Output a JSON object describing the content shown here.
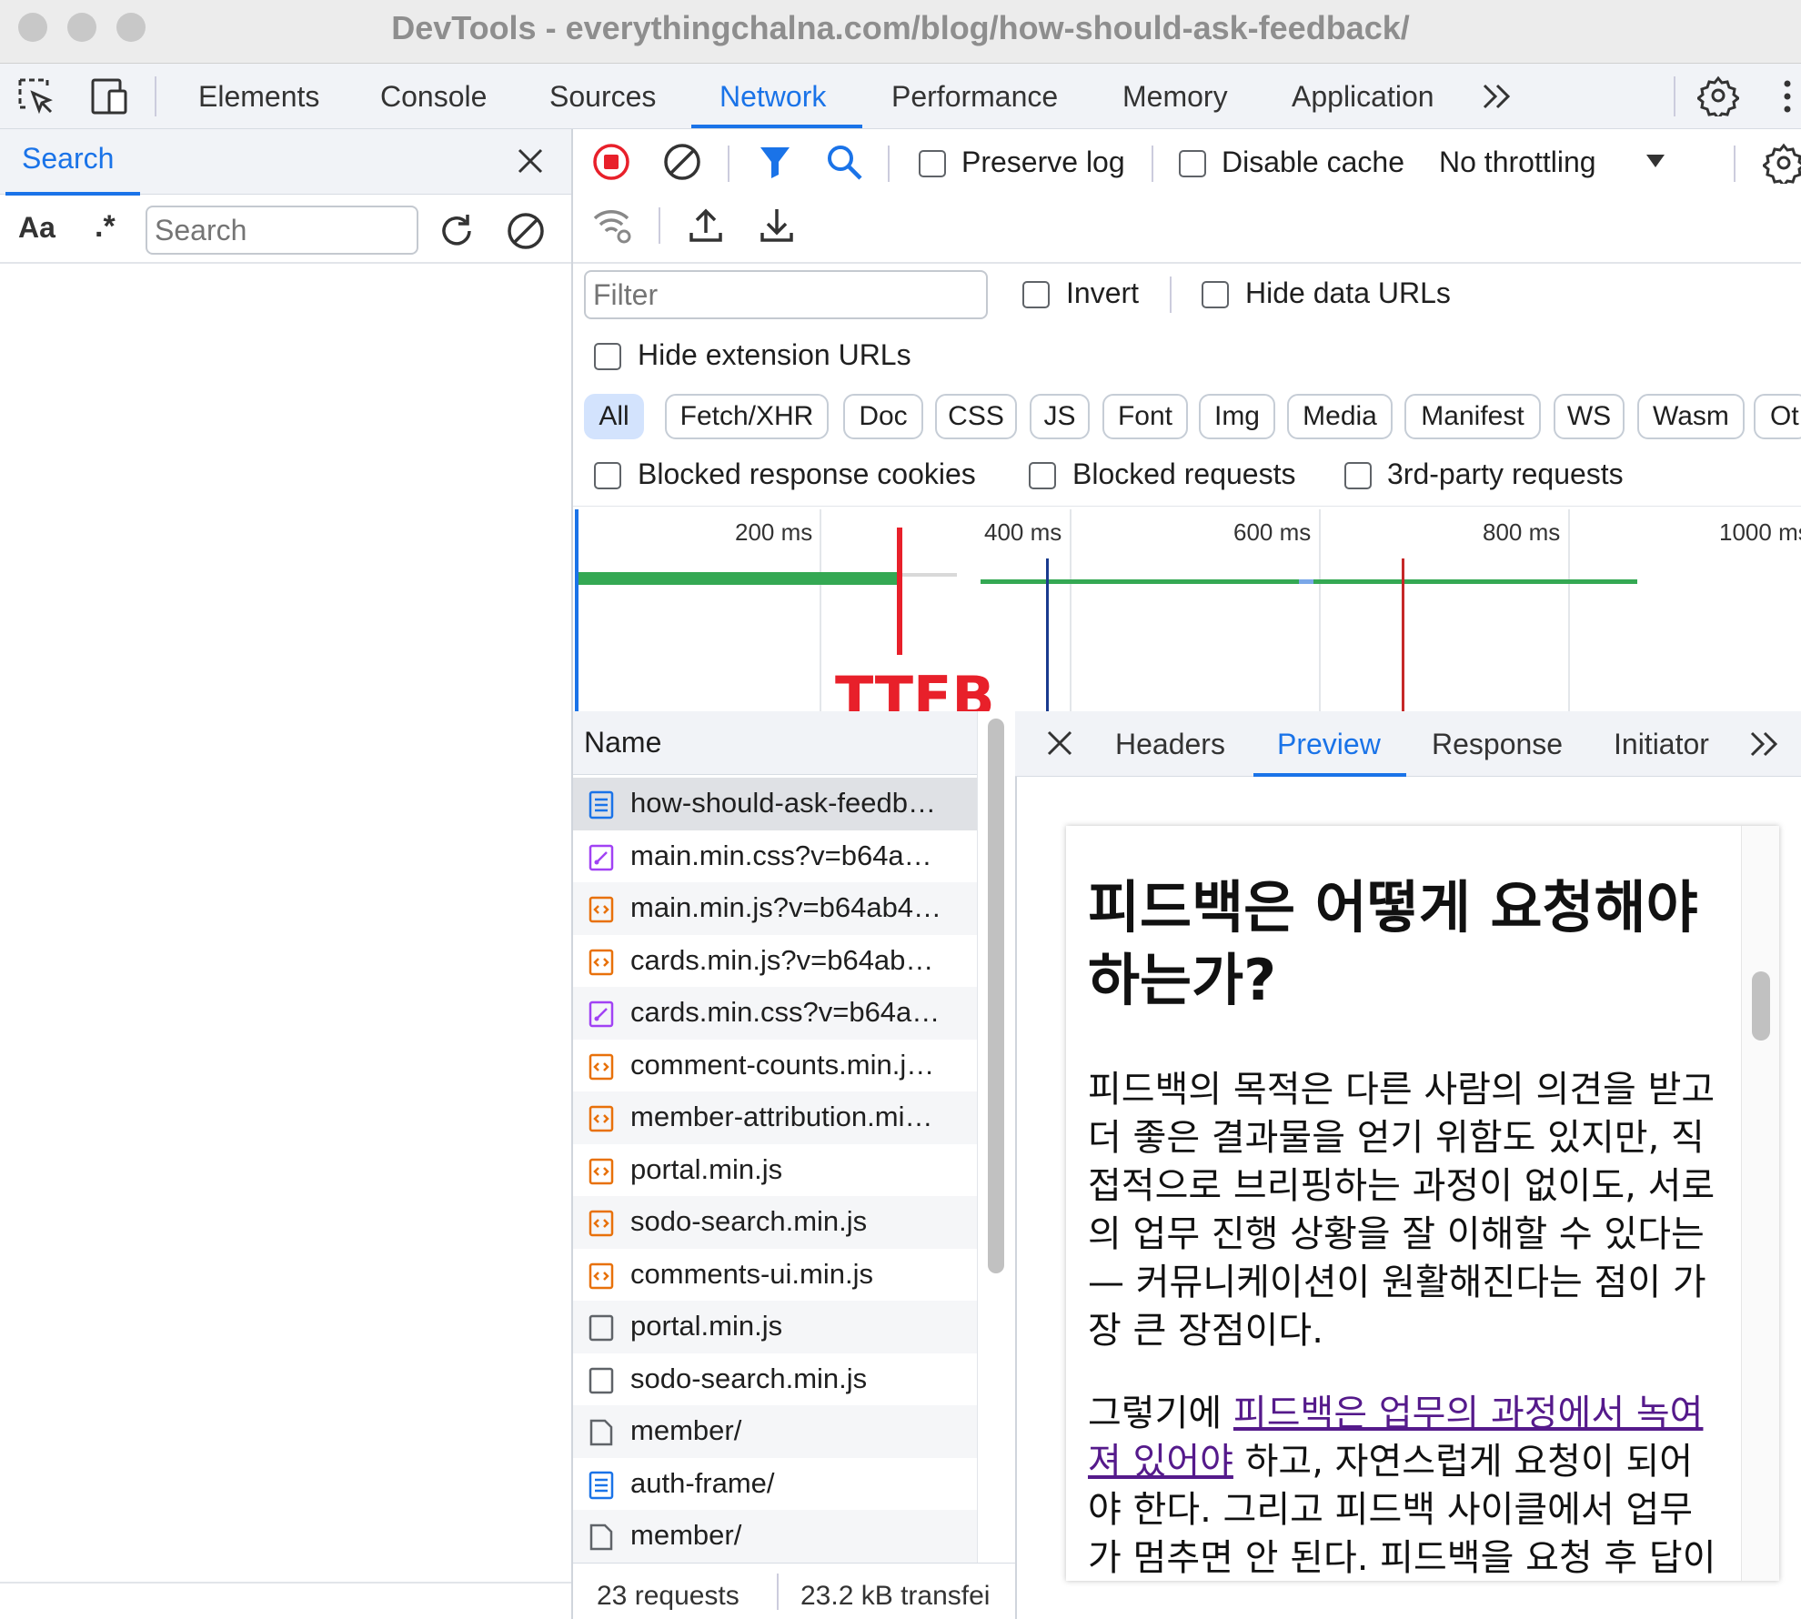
{
  "window": {
    "title": "DevTools - everythingchalna.com/blog/how-should-ask-feedback/"
  },
  "main_tabs": [
    "Elements",
    "Console",
    "Sources",
    "Network",
    "Performance",
    "Memory",
    "Application"
  ],
  "active_main_tab": "Network",
  "search_panel": {
    "title": "Search",
    "case_label": "Aa",
    "regex_label": ".*",
    "placeholder": "Search"
  },
  "network_toolbar": {
    "preserve_log": "Preserve log",
    "disable_cache": "Disable cache",
    "throttling": "No throttling"
  },
  "filter": {
    "placeholder": "Filter",
    "invert": "Invert",
    "hide_data_urls": "Hide data URLs",
    "hide_extension_urls": "Hide extension URLs"
  },
  "type_filters": [
    "All",
    "Fetch/XHR",
    "Doc",
    "CSS",
    "JS",
    "Font",
    "Img",
    "Media",
    "Manifest",
    "WS",
    "Wasm",
    "Ot"
  ],
  "active_type_filter": "All",
  "blocked": {
    "cookies": "Blocked response cookies",
    "requests": "Blocked requests",
    "third_party": "3rd-party requests"
  },
  "timeline": {
    "ticks": [
      "200 ms",
      "400 ms",
      "600 ms",
      "800 ms",
      "1000 ms"
    ],
    "annotation": "TTFB"
  },
  "requests": {
    "header": "Name",
    "rows": [
      {
        "name": "how-should-ask-feedb…",
        "icon": "document-icon"
      },
      {
        "name": "main.min.css?v=b64a…",
        "icon": "stylesheet-icon"
      },
      {
        "name": "main.min.js?v=b64ab4…",
        "icon": "script-icon"
      },
      {
        "name": "cards.min.js?v=b64ab…",
        "icon": "script-icon"
      },
      {
        "name": "cards.min.css?v=b64a…",
        "icon": "stylesheet-icon"
      },
      {
        "name": "comment-counts.min.j…",
        "icon": "script-icon"
      },
      {
        "name": "member-attribution.mi…",
        "icon": "script-icon"
      },
      {
        "name": "portal.min.js",
        "icon": "script-icon"
      },
      {
        "name": "sodo-search.min.js",
        "icon": "script-icon"
      },
      {
        "name": "comments-ui.min.js",
        "icon": "script-icon"
      },
      {
        "name": "portal.min.js",
        "icon": "blank-icon"
      },
      {
        "name": "sodo-search.min.js",
        "icon": "blank-icon"
      },
      {
        "name": "member/",
        "icon": "file-icon"
      },
      {
        "name": "auth-frame/",
        "icon": "document-icon"
      },
      {
        "name": "member/",
        "icon": "file-icon"
      }
    ]
  },
  "detail_tabs": [
    "Headers",
    "Preview",
    "Response",
    "Initiator"
  ],
  "active_detail_tab": "Preview",
  "preview": {
    "heading": "피드백은 어떻게 요청해야 하는가?",
    "paragraph1": "피드백의 목적은 다른 사람의 의견을 받고 더 좋은 결과물을 얻기 위함도 있지만, 직접적으로 브리핑하는 과정이 없이도, 서로의 업무 진행 상황을 잘 이해할 수 있다는 — 커뮤니케이션이 원활해진다는 점이 가장 큰 장점이다.",
    "paragraph2_pre": "그렇기에 ",
    "paragraph2_link": "피드백은 업무의 과정에서 녹여져 있어야",
    "paragraph2_post": " 하고, 자연스럽게 요청이 되어야 한다. 그리고 피드백 사이클에서 업무가 멈추면 안 된다. 피드백을 요청 후 답이"
  },
  "status": {
    "requests": "23 requests",
    "transferred": "23.2 kB transfei"
  },
  "colors": {
    "accent": "#1a73e8",
    "waterfall_green": "#34a853",
    "ttfb_red": "#e8202a",
    "dom_line": "#1a3b8e",
    "load_line": "#c62828"
  }
}
